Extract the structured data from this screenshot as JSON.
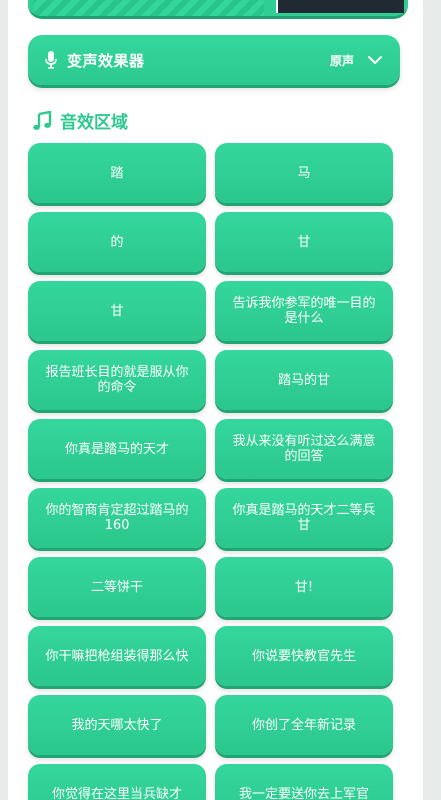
{
  "colors": {
    "accent": "#2fcf93",
    "accent_dark": "#1fa673",
    "text_on_accent": "#ffffff"
  },
  "voice_changer": {
    "title": "变声效果器",
    "current_value": "原声",
    "icon": "microphone-icon",
    "expand_icon": "chevron-down-icon"
  },
  "sound_section": {
    "title": "音效区域",
    "icon": "music-note-icon",
    "buttons": [
      "踏",
      "马",
      "的",
      "甘",
      "甘",
      "告诉我你参军的唯一目的是什么",
      "报告班长目的就是服从你的命令",
      "踏马的甘",
      "你真是踏马的天才",
      "我从来没有听过这么满意的回答",
      "你的智商肯定超过踏马的160",
      "你真是踏马的天才二等兵甘",
      "二等饼干",
      "甘!",
      "你干嘛把枪组装得那么快",
      "你说要快教官先生",
      "我的天哪太快了",
      "你创了全年新记录",
      "你觉得在这里当兵缺才",
      "我一定要送你去上军官"
    ]
  }
}
